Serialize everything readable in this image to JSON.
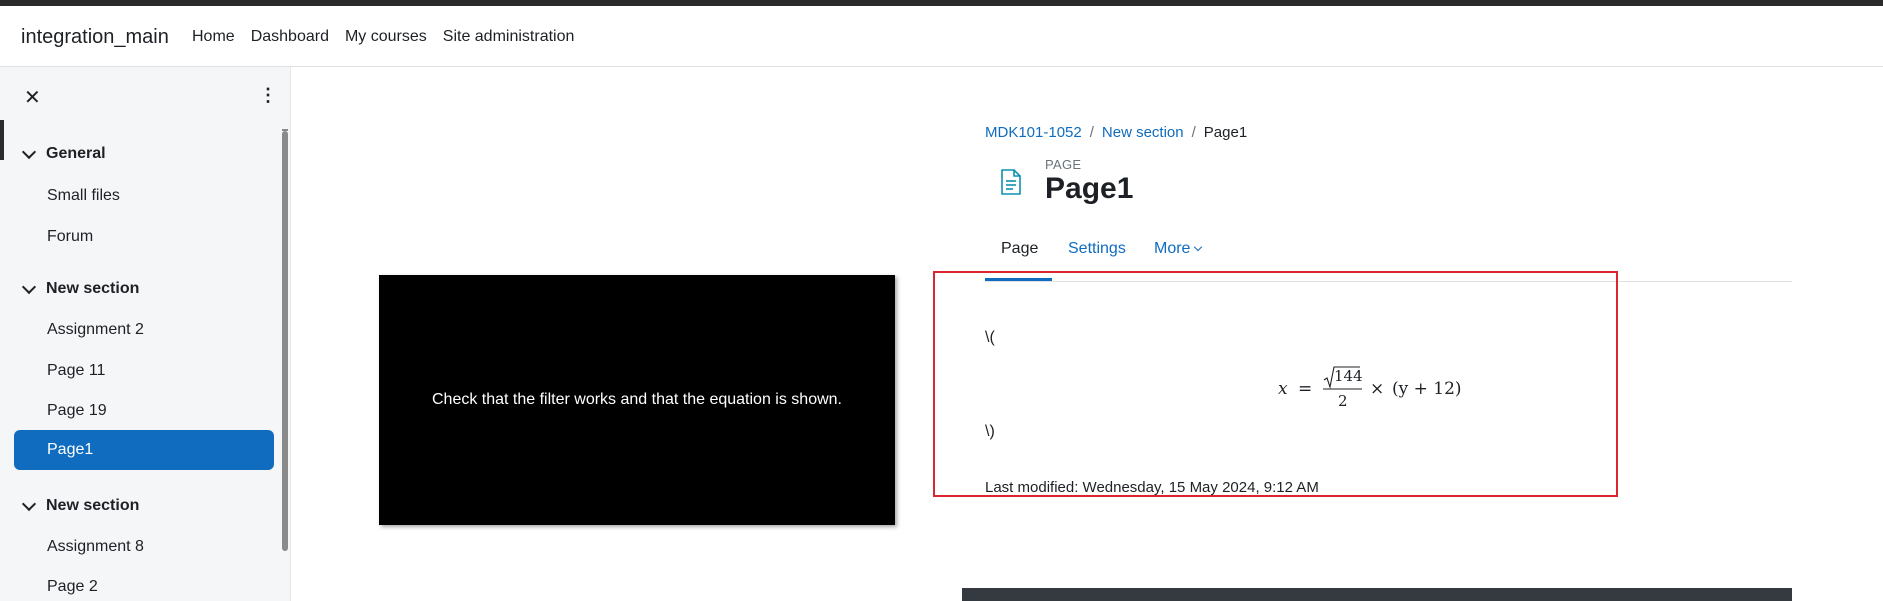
{
  "navbar": {
    "brand": "integration_main",
    "links": [
      "Home",
      "Dashboard",
      "My courses",
      "Site administration"
    ]
  },
  "drawer": {
    "close_icon": "close-icon",
    "menu_icon": "kebab-menu-icon",
    "sections": [
      {
        "title": "General",
        "items": [
          "Small files",
          "Forum"
        ]
      },
      {
        "title": "New section",
        "items": [
          "Assignment 2",
          "Page 11",
          "Page 19",
          "Page1"
        ]
      },
      {
        "title": "New section",
        "items": [
          "Assignment 8",
          "Page 2"
        ]
      }
    ],
    "active_item": "Page1"
  },
  "video": {
    "caption": "Check that the filter works and that the equation is shown."
  },
  "breadcrumb": {
    "course": "MDK101-1052",
    "section": "New section",
    "current": "Page1",
    "separator": "/"
  },
  "header": {
    "label": "PAGE",
    "title": "Page1",
    "icon": "page-document-icon"
  },
  "tabs": {
    "page": "Page",
    "settings": "Settings",
    "more": "More"
  },
  "content": {
    "latex_open": "\\(",
    "latex_close": "\\)",
    "equation": {
      "lhs": "x",
      "eq": "=",
      "sqrt_arg": "144",
      "denominator": "2",
      "times": "×",
      "rhs": "(y + 12)"
    },
    "last_modified": "Last modified: Wednesday, 15 May 2024, 9:12 AM"
  },
  "colors": {
    "accent": "#0f6cbf",
    "highlight_border": "#d9262f",
    "drawer_bg": "#f5f6f8"
  }
}
